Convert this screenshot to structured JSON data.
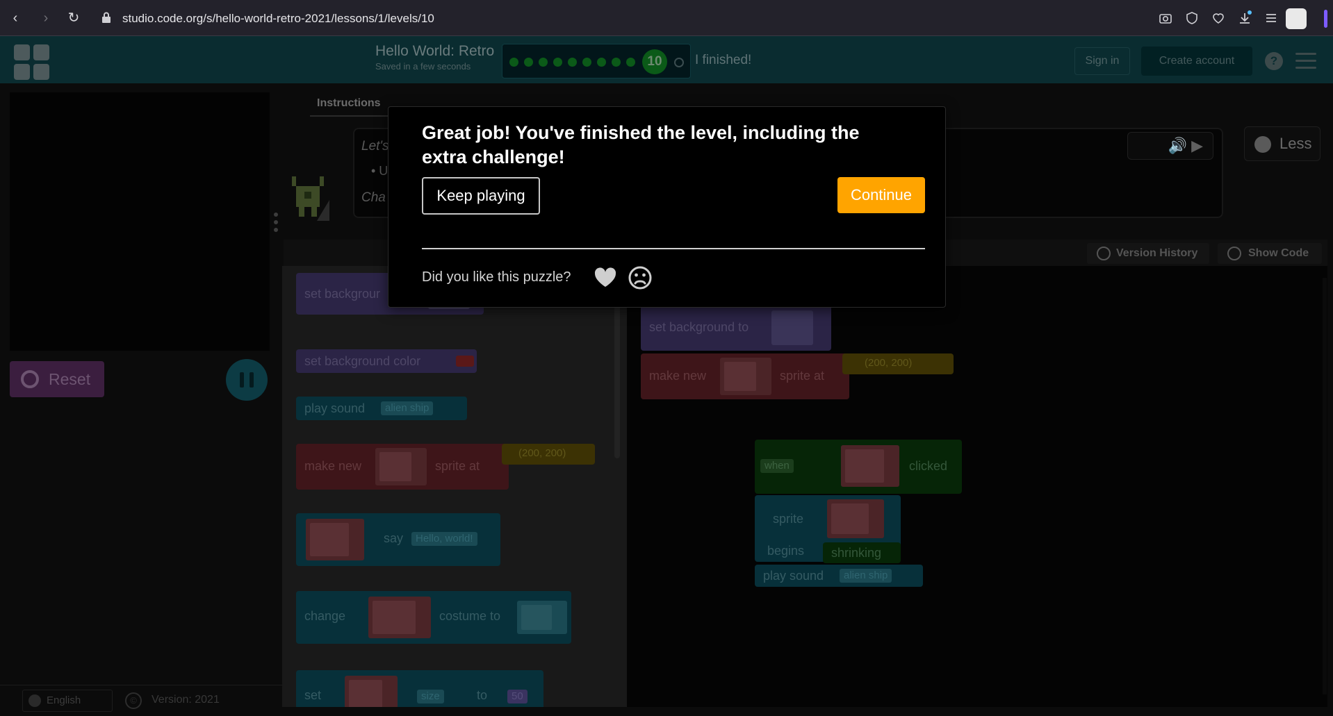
{
  "browser": {
    "url": "studio.code.org/s/hello-world-retro-2021/lessons/1/levels/10",
    "back": "‹",
    "forward": "›",
    "reload": "↻"
  },
  "header": {
    "project_title": "Hello World: Retro",
    "saved_status": "Saved in a few seconds",
    "current_level": "10",
    "finished_link": "I finished!",
    "sign_in": "Sign in",
    "create_account": "Create account",
    "help": "?"
  },
  "game": {
    "reset_label": "Reset"
  },
  "footer": {
    "language": "English",
    "copyright": "©",
    "version": "Version: 2021"
  },
  "instructions": {
    "tab": "Instructions",
    "line1": "Let's",
    "line3": "Cha",
    "less_label": "Less"
  },
  "workspace": {
    "version_history": "Version History",
    "show_code": "Show Code"
  },
  "toolbox_blocks": {
    "set_background": "set backgrour",
    "set_background_color": "set background color",
    "play_sound": "play sound",
    "play_sound_value": "alien ship",
    "make_new": "make new",
    "sprite_at": "sprite at",
    "location_value": "(200, 200)",
    "say": "say",
    "say_value": "Hello, world!",
    "change": "change",
    "costume_to": "costume to",
    "set": "set",
    "size": "size",
    "to": "to",
    "size_value": "50"
  },
  "workspace_blocks": {
    "set_background_to": "set background to",
    "make_new": "make new",
    "sprite_at": "sprite at",
    "location_value": "(200, 200)",
    "when": "when",
    "clicked": "clicked",
    "sprite": "sprite",
    "begins": "begins",
    "shrinking": "shrinking",
    "play_sound": "play sound",
    "play_sound_value": "alien ship"
  },
  "modal": {
    "title": "Great job! You've finished the level, including the extra challenge!",
    "keep_playing": "Keep playing",
    "continue": "Continue",
    "feedback_question": "Did you like this puzzle?"
  },
  "colors": {
    "continue_accent": "#ffa400",
    "header_bg": "#0a2c30",
    "modal_bg": "#000000"
  },
  "icons": [
    "lock-icon",
    "camera-icon",
    "shield-icon",
    "heart-icon",
    "download-icon",
    "menu-icon",
    "reset-icon",
    "pause-icon",
    "globe-icon",
    "speaker-icon",
    "play-icon",
    "clock-icon",
    "code-icon",
    "frown-icon"
  ]
}
